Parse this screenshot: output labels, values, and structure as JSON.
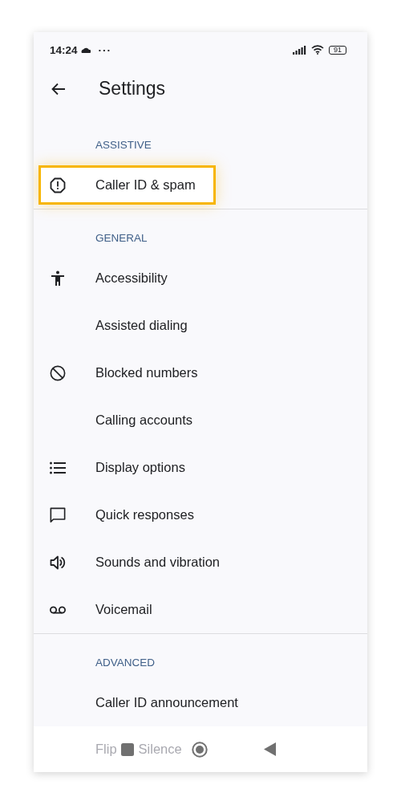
{
  "status_bar": {
    "time": "14:24",
    "more": "···",
    "battery": "91"
  },
  "title": "Settings",
  "sections": [
    {
      "header": "ASSISTIVE",
      "items": [
        {
          "label": "Caller ID & spam",
          "highlighted": true
        }
      ]
    },
    {
      "header": "GENERAL",
      "items": [
        {
          "label": "Accessibility",
          "highlighted": false
        },
        {
          "label": "Assisted dialing",
          "highlighted": false
        },
        {
          "label": "Blocked numbers",
          "highlighted": false
        },
        {
          "label": "Calling accounts",
          "highlighted": false
        },
        {
          "label": "Display options",
          "highlighted": false
        },
        {
          "label": "Quick responses",
          "highlighted": false
        },
        {
          "label": "Sounds and vibration",
          "highlighted": false
        },
        {
          "label": "Voicemail",
          "highlighted": false
        }
      ]
    },
    {
      "header": "ADVANCED",
      "items": [
        {
          "label": "Caller ID announcement",
          "highlighted": false
        }
      ]
    }
  ],
  "partial_row": {
    "parts": [
      "Flip",
      "Silence"
    ]
  }
}
